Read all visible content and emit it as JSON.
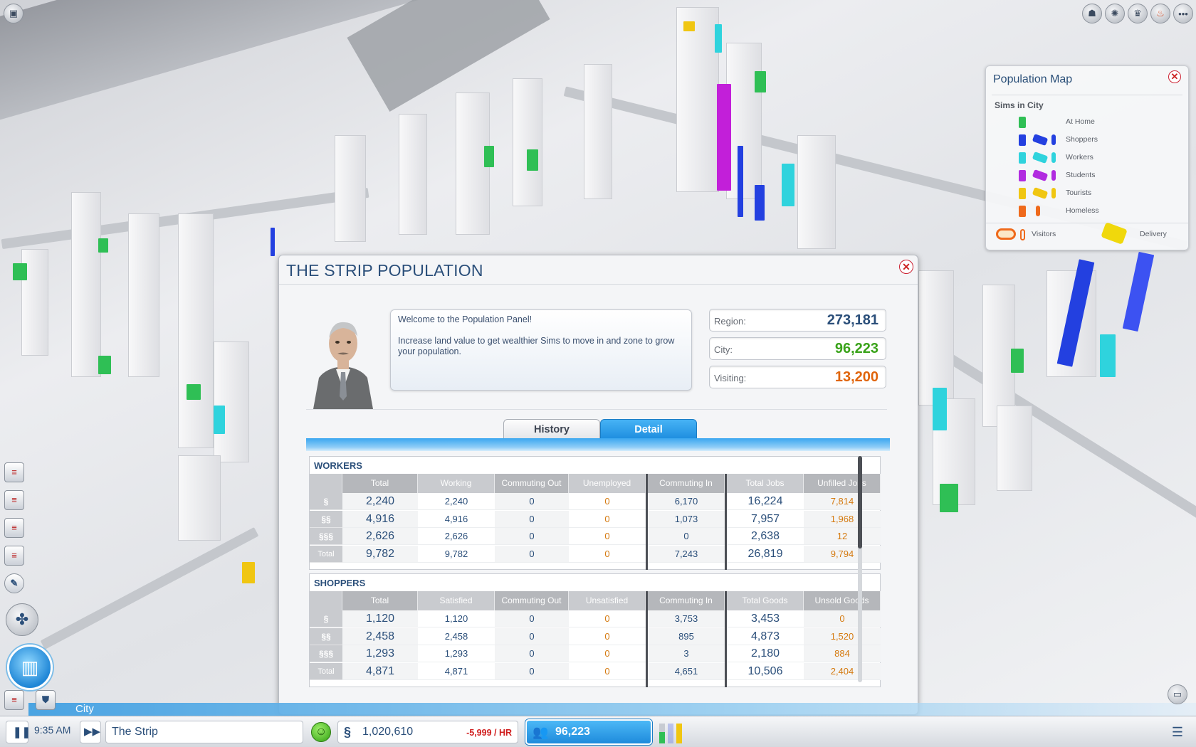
{
  "population_map": {
    "title": "Population Map",
    "subtitle": "Sims in City",
    "legend": [
      {
        "label": "At Home",
        "color": "#2fbf55"
      },
      {
        "label": "Shoppers",
        "color": "#2340e0"
      },
      {
        "label": "Workers",
        "color": "#2fd3dd"
      },
      {
        "label": "Students",
        "color": "#b12ce0"
      },
      {
        "label": "Tourists",
        "color": "#f0c612"
      },
      {
        "label": "Homeless",
        "color": "#ef6a1c"
      }
    ],
    "footer": {
      "visitors": "Visitors",
      "delivery": "Delivery"
    }
  },
  "panel": {
    "title": "THE STRIP POPULATION",
    "advisor_message_1": "Welcome to the Population Panel!",
    "advisor_message_2": "Increase land value to get wealthier Sims to move in and zone to grow your population.",
    "stats": [
      {
        "label": "Region:",
        "value": "273,181",
        "color": "#2b4f7a"
      },
      {
        "label": "City:",
        "value": "96,223",
        "color": "#3aa31a"
      },
      {
        "label": "Visiting:",
        "value": "13,200",
        "color": "#e0650c"
      }
    ],
    "tabs": {
      "history": "History",
      "detail": "Detail"
    },
    "workers": {
      "title": "WORKERS",
      "headers": [
        "Total",
        "Working",
        "Commuting Out",
        "Unemployed",
        "Commuting In",
        "Total Jobs",
        "Unfilled Jobs"
      ],
      "rows": [
        {
          "icon": "§",
          "values": [
            "2,240",
            "2,240",
            "0",
            "0",
            "6,170",
            "16,224",
            "7,814"
          ]
        },
        {
          "icon": "§§",
          "values": [
            "4,916",
            "4,916",
            "0",
            "0",
            "1,073",
            "7,957",
            "1,968"
          ]
        },
        {
          "icon": "§§§",
          "values": [
            "2,626",
            "2,626",
            "0",
            "0",
            "0",
            "2,638",
            "12"
          ]
        },
        {
          "icon": "Total",
          "values": [
            "9,782",
            "9,782",
            "0",
            "0",
            "7,243",
            "26,819",
            "9,794"
          ]
        }
      ]
    },
    "shoppers": {
      "title": "SHOPPERS",
      "headers": [
        "Total",
        "Satisfied",
        "Commuting Out",
        "Unsatisfied",
        "Commuting In",
        "Total Goods",
        "Unsold Goods"
      ],
      "rows": [
        {
          "icon": "§",
          "values": [
            "1,120",
            "1,120",
            "0",
            "0",
            "3,753",
            "3,453",
            "0"
          ]
        },
        {
          "icon": "§§",
          "values": [
            "2,458",
            "2,458",
            "0",
            "0",
            "895",
            "4,873",
            "1,520"
          ]
        },
        {
          "icon": "§§§",
          "values": [
            "1,293",
            "1,293",
            "0",
            "0",
            "3",
            "2,180",
            "884"
          ]
        },
        {
          "icon": "Total",
          "values": [
            "4,871",
            "4,871",
            "0",
            "0",
            "4,651",
            "10,506",
            "2,404"
          ]
        }
      ]
    }
  },
  "bottom_bar": {
    "city_label": "City",
    "time": "9:35 AM",
    "city_name": "The Strip",
    "funds": "1,020,610",
    "rate": "-5,999 / HR",
    "population": "96,223"
  }
}
